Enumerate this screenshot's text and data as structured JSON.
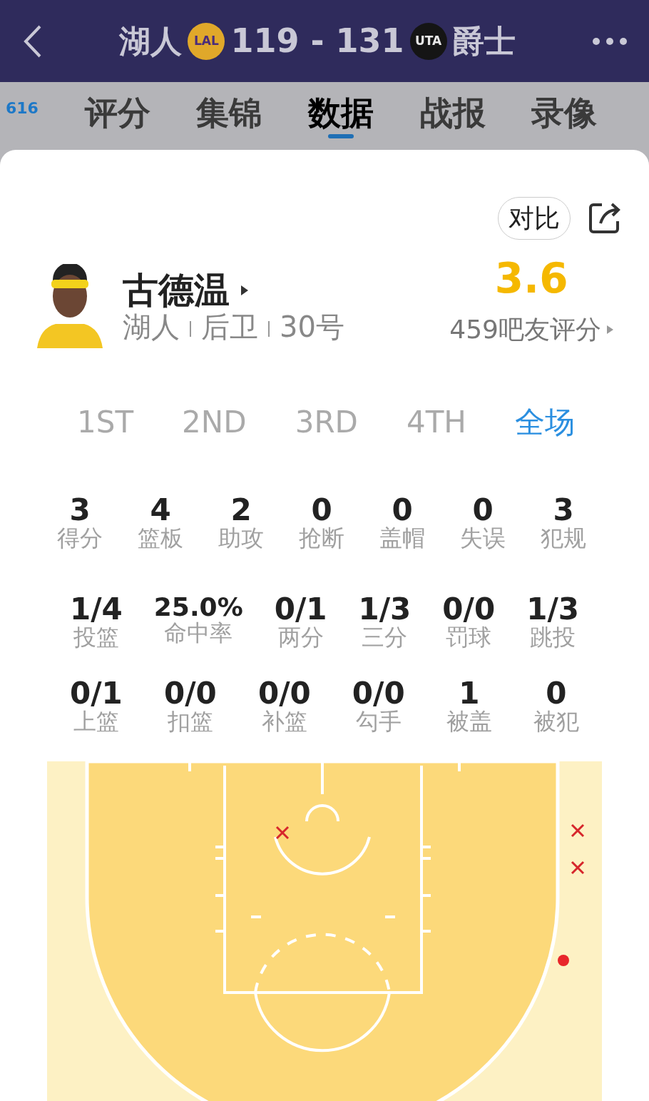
{
  "header": {
    "home_team": "湖人",
    "home_logo": "LAL",
    "score": "119 - 131",
    "away_logo": "UTA",
    "away_team": "爵士"
  },
  "comment_badge": "616",
  "tabs": [
    {
      "label": "评分",
      "selected": false
    },
    {
      "label": "集锦",
      "selected": false
    },
    {
      "label": "数据",
      "selected": true
    },
    {
      "label": "战报",
      "selected": false
    },
    {
      "label": "录像",
      "selected": false
    }
  ],
  "compare_button": "对比",
  "player": {
    "name": "古德温",
    "team": "湖人",
    "position": "后卫",
    "number": "30号",
    "rating": "3.6",
    "rating_count": "459吧友评分"
  },
  "periods": [
    {
      "label": "1ST",
      "selected": false
    },
    {
      "label": "2ND",
      "selected": false
    },
    {
      "label": "3RD",
      "selected": false
    },
    {
      "label": "4TH",
      "selected": false
    },
    {
      "label": "全场",
      "selected": true
    }
  ],
  "stat_rows": [
    [
      {
        "value": "3",
        "label": "得分"
      },
      {
        "value": "4",
        "label": "篮板"
      },
      {
        "value": "2",
        "label": "助攻"
      },
      {
        "value": "0",
        "label": "抢断"
      },
      {
        "value": "0",
        "label": "盖帽"
      },
      {
        "value": "0",
        "label": "失误"
      },
      {
        "value": "3",
        "label": "犯规"
      }
    ],
    [
      {
        "value": "1/4",
        "label": "投篮"
      },
      {
        "value": "25.0%",
        "label": "命中率"
      },
      {
        "value": "0/1",
        "label": "两分"
      },
      {
        "value": "1/3",
        "label": "三分"
      },
      {
        "value": "0/0",
        "label": "罚球"
      },
      {
        "value": "1/3",
        "label": "跳投"
      }
    ],
    [
      {
        "value": "0/1",
        "label": "上篮"
      },
      {
        "value": "0/0",
        "label": "扣篮"
      },
      {
        "value": "0/0",
        "label": "补篮"
      },
      {
        "value": "0/0",
        "label": "勾手"
      },
      {
        "value": "1",
        "label": "被盖"
      },
      {
        "value": "0",
        "label": "被犯"
      }
    ]
  ],
  "shots": [
    {
      "kind": "missed"
    },
    {
      "kind": "missed"
    },
    {
      "kind": "missed"
    },
    {
      "kind": "made"
    }
  ]
}
